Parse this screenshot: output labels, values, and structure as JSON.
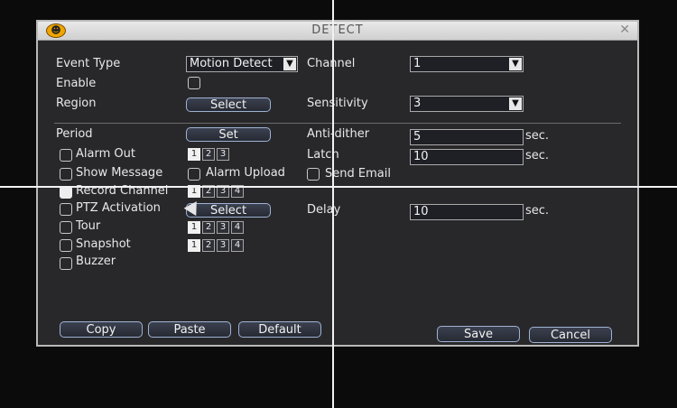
{
  "window": {
    "title": "DETECT",
    "close_glyph": "✕",
    "icon": "running-person-icon"
  },
  "fields": {
    "event_type": {
      "label": "Event Type",
      "value": "Motion Detect"
    },
    "enable": {
      "label": "Enable",
      "checked": false
    },
    "region": {
      "label": "Region",
      "button": "Select"
    },
    "channel": {
      "label": "Channel",
      "value": "1"
    },
    "sensitivity": {
      "label": "Sensitivity",
      "value": "3"
    },
    "period": {
      "label": "Period",
      "button": "Set"
    },
    "anti_dither": {
      "label": "Anti-dither",
      "value": "5",
      "unit": "sec."
    },
    "alarm_out": {
      "label": "Alarm Out",
      "checked": false,
      "options": [
        "1",
        "2",
        "3"
      ],
      "selected": [
        "1"
      ]
    },
    "latch": {
      "label": "Latch",
      "value": "10",
      "unit": "sec."
    },
    "show_message": {
      "label": "Show Message",
      "checked": false
    },
    "alarm_upload": {
      "label": "Alarm Upload",
      "checked": false
    },
    "send_email": {
      "label": "Send Email",
      "checked": false
    },
    "record_channel": {
      "label": "Record Channel",
      "checked": true,
      "options": [
        "1",
        "2",
        "3",
        "4"
      ],
      "selected": [
        "1"
      ]
    },
    "ptz_activation": {
      "label": "PTZ Activation",
      "checked": false,
      "button": "Select"
    },
    "delay": {
      "label": "Delay",
      "value": "10",
      "unit": "sec."
    },
    "tour": {
      "label": "Tour",
      "checked": false,
      "options": [
        "1",
        "2",
        "3",
        "4"
      ],
      "selected": [
        "1"
      ]
    },
    "snapshot": {
      "label": "Snapshot",
      "checked": false,
      "options": [
        "1",
        "2",
        "3",
        "4"
      ],
      "selected": [
        "1"
      ]
    },
    "buzzer": {
      "label": "Buzzer",
      "checked": false
    }
  },
  "buttons": {
    "copy": "Copy",
    "paste": "Paste",
    "default": "Default",
    "save": "Save",
    "cancel": "Cancel"
  },
  "dropdown_arrow": "▼",
  "colors": {
    "window_bg": "#28282b",
    "titlebar": "#dcdcdc",
    "icon": "#f0a600",
    "button_border": "#9fb2d3"
  }
}
